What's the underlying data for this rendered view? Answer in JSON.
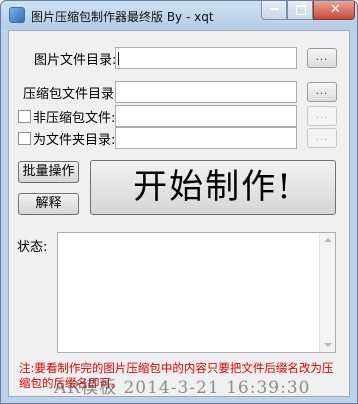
{
  "window": {
    "title": "图片压缩包制作器最终版 By - xqt"
  },
  "fields": {
    "image_dir": {
      "label": "图片文件目录:",
      "browse": "..."
    },
    "archive_dir": {
      "label": "压缩包文件目录:",
      "browse": "..."
    },
    "non_archive": {
      "label": "非压缩包文件:",
      "checked": false,
      "browse": "..."
    },
    "as_folder": {
      "label": "为文件夹目录:",
      "checked": false,
      "browse": "..."
    }
  },
  "buttons": {
    "batch": "批量操作",
    "explain": "解释",
    "start": "开始制作!"
  },
  "status": {
    "label": "状态:"
  },
  "note": "注:要看制作完的图片压缩包中的内容只要把文件后缀名改为压缩包的后缀名即可。",
  "watermark": "AR模板 2014-3-21 16:39:30"
}
